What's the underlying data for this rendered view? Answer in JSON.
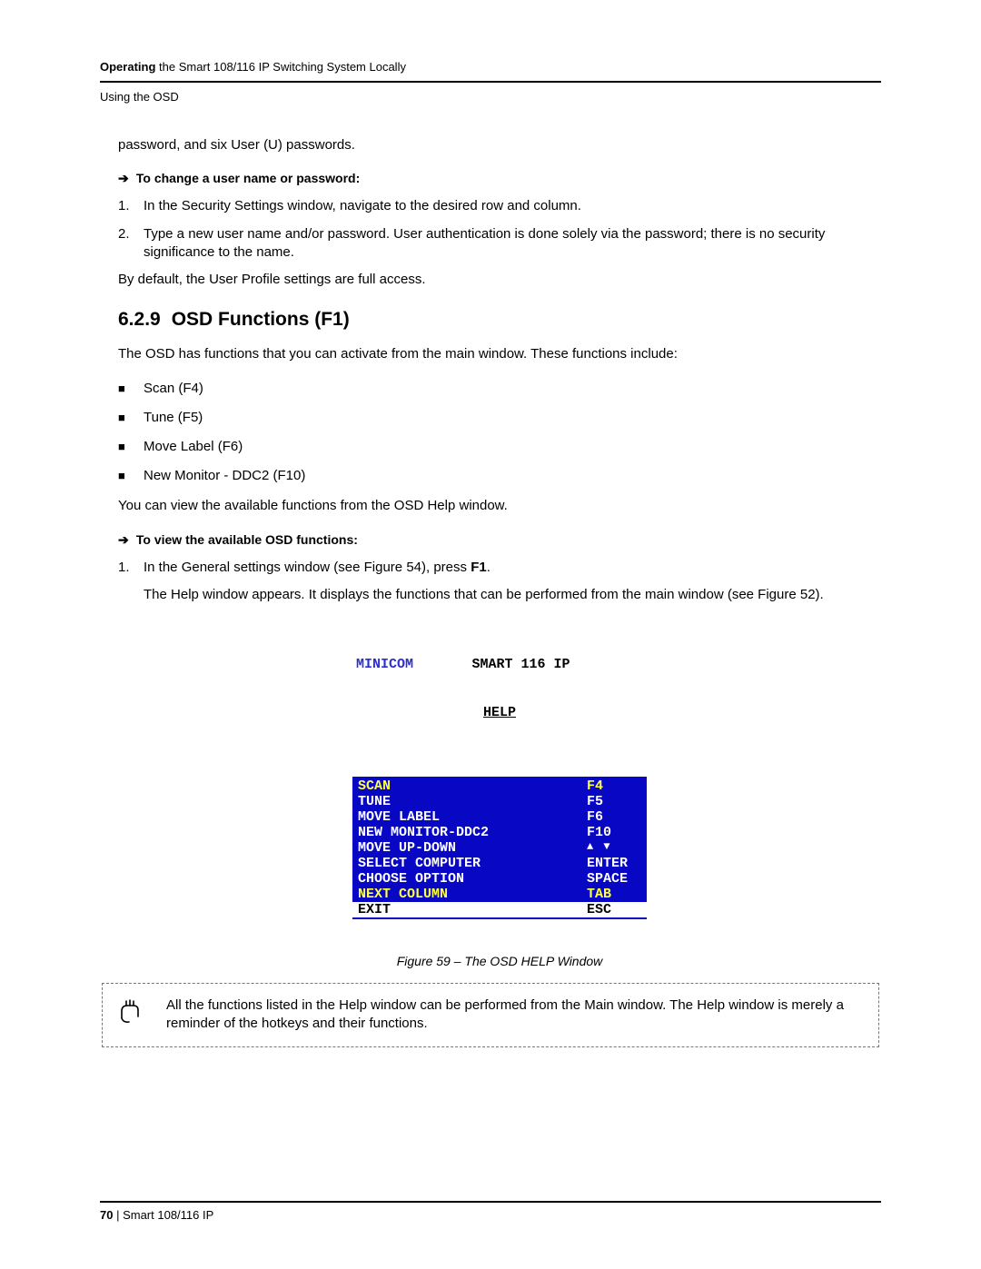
{
  "header": {
    "bold": "Operating",
    "rest": " the Smart 108/116 IP Switching System Locally",
    "sub": "Using the OSD"
  },
  "intro": {
    "line1": "password, and six User (U) passwords.",
    "changeHead": "To change a user name or password:",
    "steps": [
      "In the Security Settings window, navigate to the desired row and column.",
      "Type a new user name and/or password. User authentication is done solely via the password; there is no security significance to the name."
    ],
    "defaultNote": "By default, the User Profile settings are full access."
  },
  "section": {
    "num": "6.2.9",
    "title": "OSD Functions (F1)",
    "lead": "The OSD has functions that you can activate from the main window. These functions include:",
    "bullets": [
      "Scan (F4)",
      "Tune (F5)",
      "Move Label (F6)",
      "New Monitor - DDC2 (F10)"
    ],
    "after": "You can view the available functions from the OSD Help window.",
    "viewHead": "To view the available OSD functions:",
    "viewStep1a": "In the General settings window (see Figure 54), press ",
    "viewStep1b": "F1",
    "viewStep1c": ".",
    "helpPara": "The Help window appears. It displays the functions that can be performed from the main window (see Figure 52)."
  },
  "osd": {
    "brand": "MINICOM",
    "title": "SMART 116 IP",
    "subtitle": "HELP",
    "rows": [
      {
        "l": "SCAN",
        "r": "F4",
        "hl": true
      },
      {
        "l": "TUNE",
        "r": "F5",
        "hl": false
      },
      {
        "l": "MOVE LABEL",
        "r": "F6",
        "hl": false
      },
      {
        "l": "NEW MONITOR-DDC2",
        "r": "F10",
        "hl": false
      },
      {
        "l": "MOVE UP-DOWN",
        "r": "▲ ▼",
        "hl": false,
        "arrows": true
      },
      {
        "l": "SELECT COMPUTER",
        "r": "ENTER",
        "hl": false
      },
      {
        "l": "CHOOSE OPTION",
        "r": "SPACE",
        "hl": false
      },
      {
        "l": "NEXT COLUMN",
        "r": "TAB",
        "hl": true
      }
    ],
    "exit": {
      "l": "EXIT",
      "r": "ESC"
    }
  },
  "figcaption": "Figure 59 – The OSD HELP Window",
  "note": "All the functions listed in the Help window can be performed from the Main window. The Help window is merely a reminder of the hotkeys and their functions.",
  "footer": {
    "page": "70",
    "sep": "  |  ",
    "doc": "Smart 108/116 IP"
  }
}
